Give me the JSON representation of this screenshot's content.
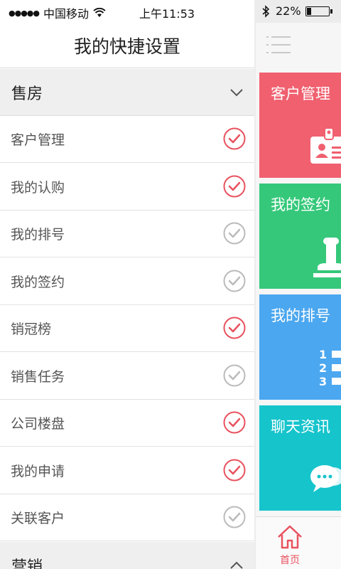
{
  "status": {
    "carrier": "中国移动",
    "time": "上午11:53",
    "battery": "22%",
    "battery_level": 0.22
  },
  "title": "我的快捷设置",
  "sections": [
    {
      "label": "售房",
      "expanded": true,
      "items": [
        {
          "label": "客户管理",
          "checked": true
        },
        {
          "label": "我的认购",
          "checked": true
        },
        {
          "label": "我的排号",
          "checked": false
        },
        {
          "label": "我的签约",
          "checked": false
        },
        {
          "label": "销冠榜",
          "checked": true
        },
        {
          "label": "销售任务",
          "checked": false
        },
        {
          "label": "公司楼盘",
          "checked": true
        },
        {
          "label": "我的申请",
          "checked": true
        },
        {
          "label": "关联客户",
          "checked": false
        }
      ]
    },
    {
      "label": "营销",
      "expanded": false
    }
  ],
  "tiles": [
    {
      "label": "客户管理",
      "color": "#f0606f",
      "icon": "id-card-icon"
    },
    {
      "label": "我的签约",
      "color": "#35c87a",
      "icon": "stamp-icon"
    },
    {
      "label": "我的排号",
      "color": "#4ba7ef",
      "icon": "numbered-list-icon"
    },
    {
      "label": "聊天资讯",
      "color": "#16c4cc",
      "icon": "chat-bubbles-icon"
    }
  ],
  "tabbar": {
    "home_label": "首页"
  },
  "colors": {
    "checked": "#e8525f",
    "unchecked": "#bbbbbb"
  }
}
